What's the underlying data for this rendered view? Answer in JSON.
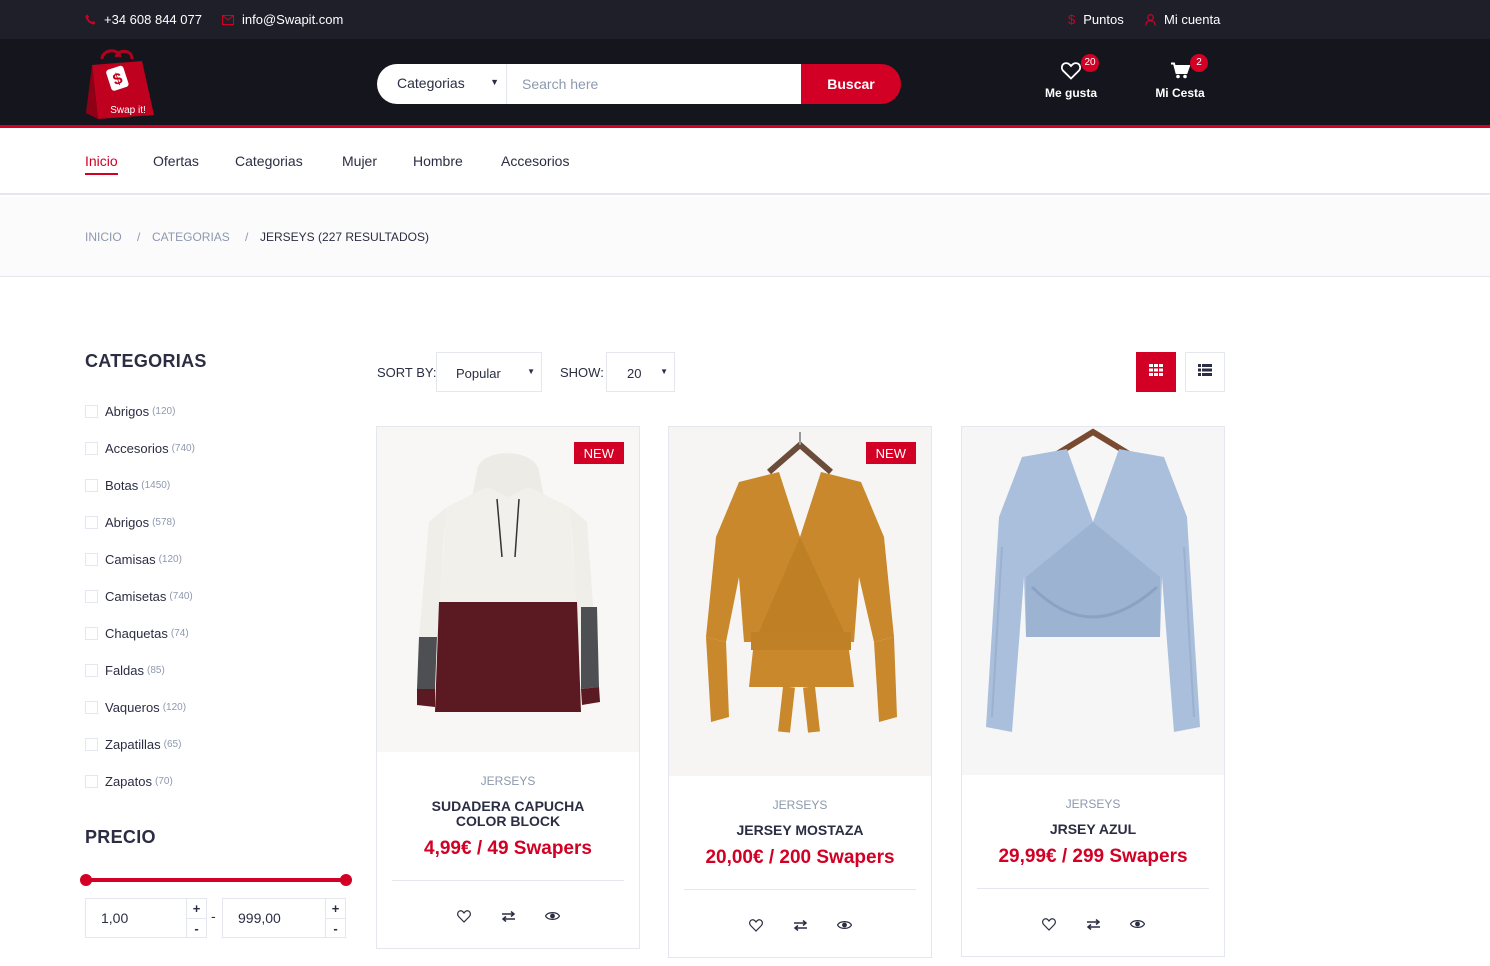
{
  "topbar": {
    "phone": "+34 608 844 077",
    "email": "info@Swapit.com",
    "points": "Puntos",
    "account": "Mi cuenta"
  },
  "header": {
    "logo_text": "Swap it!",
    "search_category": "Categorias",
    "search_placeholder": "Search here",
    "search_button": "Buscar",
    "wishlist_label": "Me gusta",
    "wishlist_count": "20",
    "cart_label": "Mi Cesta",
    "cart_count": "2"
  },
  "nav": [
    "Inicio",
    "Ofertas",
    "Categorias",
    "Mujer",
    "Hombre",
    "Accesorios"
  ],
  "breadcrumb": {
    "home": "Inicio",
    "category": "Categorias",
    "current": "JERSEYS (227 RESULTADOS)",
    "separator": "/"
  },
  "aside": {
    "categories_title": "CATEGORIAS",
    "categories": [
      {
        "label": "Abrigos",
        "count": "(120)"
      },
      {
        "label": "Accesorios",
        "count": "(740)"
      },
      {
        "label": "Botas",
        "count": "(1450)"
      },
      {
        "label": "Abrigos",
        "count": "(578)"
      },
      {
        "label": "Camisas",
        "count": "(120)"
      },
      {
        "label": "Camisetas",
        "count": "(740)"
      },
      {
        "label": "Chaquetas",
        "count": "(74)"
      },
      {
        "label": "Faldas",
        "count": "(85)"
      },
      {
        "label": "Vaqueros",
        "count": "(120)"
      },
      {
        "label": "Zapatillas",
        "count": "(65)"
      },
      {
        "label": "Zapatos",
        "count": "(70)"
      }
    ],
    "price_title": "PRECIO",
    "price_min": "1,00",
    "price_max": "999,00"
  },
  "store": {
    "sort_label": "SORT BY:",
    "sort_value": "Popular",
    "show_label": "SHOW:",
    "show_value": "20"
  },
  "products": [
    {
      "tag": "NEW",
      "category": "JERSEYS",
      "name": "SUDADERA CAPUCHA COLOR BLOCK",
      "price": "4,99€ / 49 Swapers"
    },
    {
      "tag": "NEW",
      "category": "JERSEYS",
      "name": "JERSEY MOSTAZA",
      "price": "20,00€ / 200 Swapers"
    },
    {
      "tag": "",
      "category": "JERSEYS",
      "name": "JRSEY AZUL",
      "price": "29,99€ / 299 Swapers"
    }
  ],
  "colors": {
    "accent": "#d10024",
    "dark": "#15161d",
    "topbar": "#1e1f29",
    "text": "#2b2d42",
    "muted": "#8d99ae"
  }
}
